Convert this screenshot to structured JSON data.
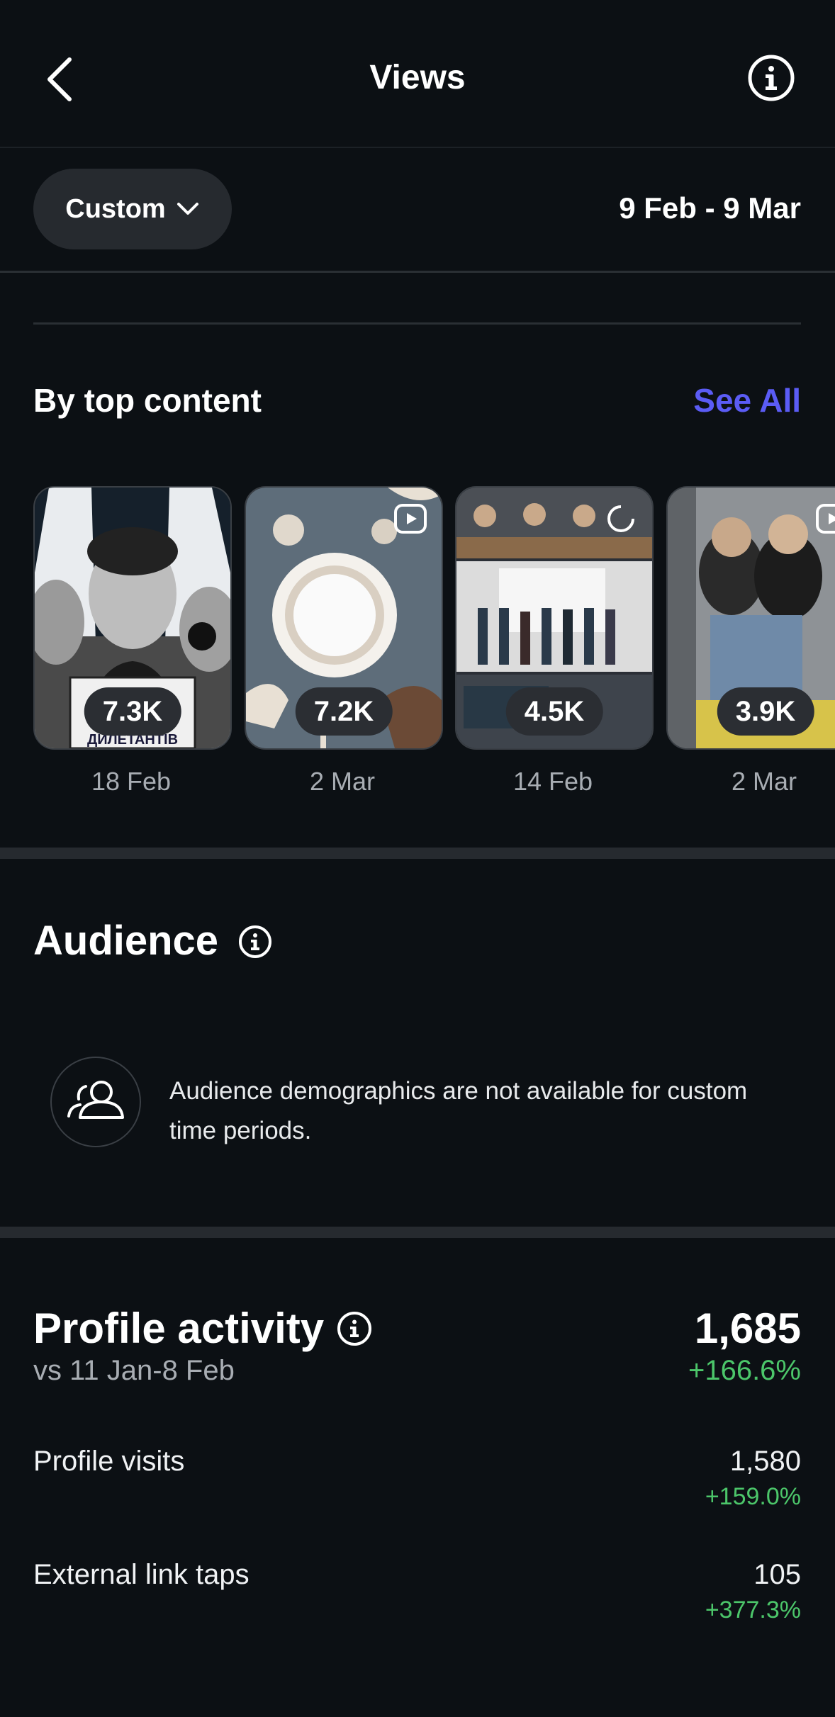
{
  "header": {
    "title": "Views"
  },
  "filter": {
    "period_label": "Custom",
    "date_range": "9 Feb - 9 Mar"
  },
  "top_content": {
    "title": "By top content",
    "see_all": "See All",
    "items": [
      {
        "count": "7.3K",
        "date": "18 Feb",
        "caption": "ДИЛЕТАНТІВ"
      },
      {
        "count": "7.2K",
        "date": "2 Mar"
      },
      {
        "count": "4.5K",
        "date": "14 Feb"
      },
      {
        "count": "3.9K",
        "date": "2 Mar"
      }
    ]
  },
  "audience": {
    "title": "Audience",
    "message": "Audience demographics are not available for custom time periods."
  },
  "profile_activity": {
    "title": "Profile activity",
    "total": "1,685",
    "comparison": "vs 11 Jan-8 Feb",
    "change": "+166.6%",
    "metrics": [
      {
        "label": "Profile visits",
        "value": "1,580",
        "change": "+159.0%"
      },
      {
        "label": "External link taps",
        "value": "105",
        "change": "+377.3%"
      }
    ]
  },
  "colors": {
    "background": "#0c1014",
    "accent": "#5b5cf5",
    "positive": "#4cc66a",
    "muted": "#a8adb3"
  }
}
